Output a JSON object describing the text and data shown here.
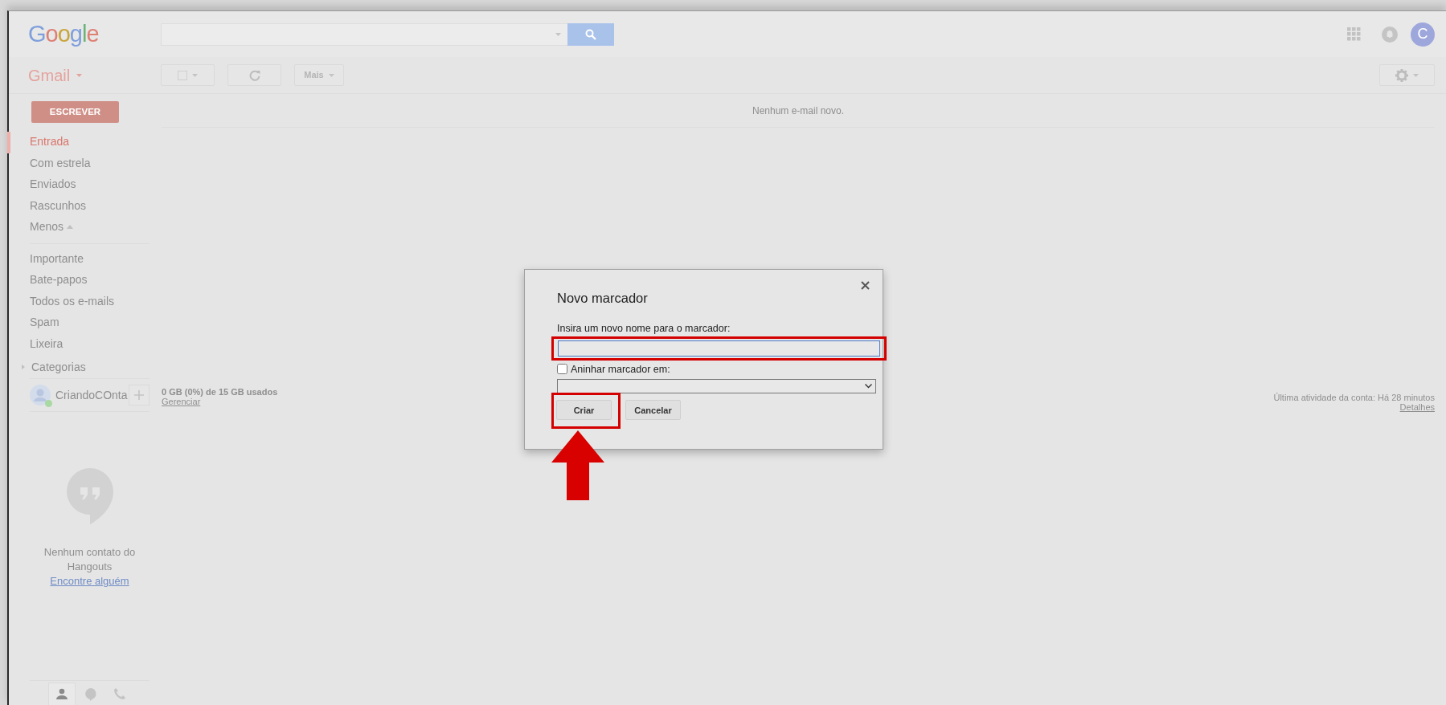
{
  "header": {
    "logo": "Google",
    "avatar_letter": "C"
  },
  "toolbar": {
    "app": "Gmail",
    "more": "Mais"
  },
  "compose": "ESCREVER",
  "nav": [
    {
      "label": "Entrada",
      "selected": true
    },
    {
      "label": "Com estrela",
      "selected": false
    },
    {
      "label": "Enviados",
      "selected": false
    },
    {
      "label": "Rascunhos",
      "selected": false
    }
  ],
  "less": "Menos",
  "nav_more": [
    {
      "label": "Importante",
      "selected": false
    },
    {
      "label": "Bate-papos",
      "selected": false
    },
    {
      "label": "Todos os e-mails",
      "selected": false
    },
    {
      "label": "Spam",
      "selected": false
    },
    {
      "label": "Lixeira",
      "selected": false
    }
  ],
  "categories": "Categorias",
  "contact": {
    "name": "CriandoCOnta",
    "online": true
  },
  "storage": {
    "usage": "0 GB (0%) de 15 GB usados",
    "manage": "Gerenciar"
  },
  "message": "Nenhum e-mail novo.",
  "activity": {
    "text": "Última atividade da conta: Há 28 minutos",
    "details": "Detalhes"
  },
  "hangouts": {
    "empty": "Nenhum contato do Hangouts",
    "link": "Encontre alguém",
    "tabs": [
      {
        "kind": "person",
        "selected": true
      },
      {
        "kind": "chat",
        "selected": false
      },
      {
        "kind": "phone",
        "selected": false
      }
    ]
  },
  "dialog": {
    "title": "Novo marcador",
    "name_label": "Insira um novo nome para o marcador:",
    "input_highlighted": true,
    "nest_label": "Aninhar marcador em:",
    "nest_checked": false,
    "buttons": [
      {
        "label": "Criar",
        "highlighted": true
      },
      {
        "label": "Cancelar",
        "highlighted": false
      }
    ]
  }
}
